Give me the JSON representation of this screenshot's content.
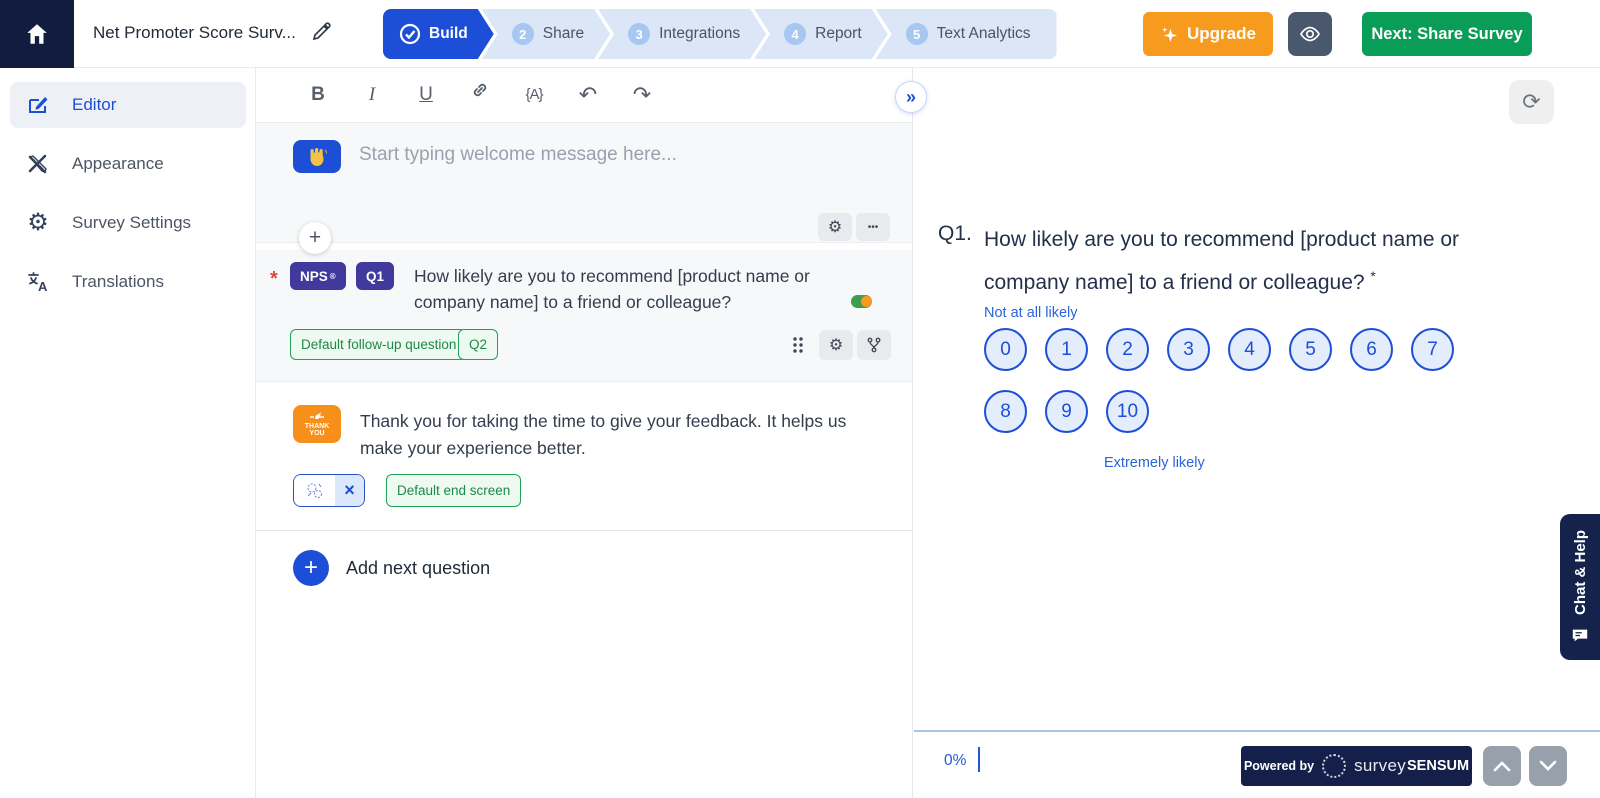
{
  "topbar": {
    "survey_title": "Net Promoter Score Surv...",
    "steps": [
      {
        "label": "Build",
        "number": "",
        "state": "active"
      },
      {
        "label": "Share",
        "number": "2",
        "state": "upcoming"
      },
      {
        "label": "Integrations",
        "number": "3",
        "state": "upcoming"
      },
      {
        "label": "Report",
        "number": "4",
        "state": "upcoming"
      },
      {
        "label": "Text Analytics",
        "number": "5",
        "state": "upcoming"
      }
    ],
    "upgrade_label": "Upgrade",
    "next_label": "Next: Share Survey"
  },
  "sidebar": {
    "items": [
      {
        "label": "Editor",
        "active": true
      },
      {
        "label": "Appearance",
        "active": false
      },
      {
        "label": "Survey Settings",
        "active": false
      },
      {
        "label": "Translations",
        "active": false
      }
    ]
  },
  "toolbar": {
    "bold": "B",
    "italic": "I",
    "underline": "U",
    "variable": "{A}"
  },
  "editor": {
    "welcome": {
      "placeholder": "Start typing welcome message here..."
    },
    "nps": {
      "required_marker": "*",
      "type_badge": "NPS",
      "type_reg": "®",
      "q_badge": "Q1",
      "question": "How likely are you to recommend [product name or company name] to a friend or colleague?",
      "toggle_state": "on",
      "followup_tag": "Default follow-up question",
      "followup_q": "Q2"
    },
    "thankyou": {
      "icon_line1": "THANK",
      "icon_line2": "YOU",
      "message": "Thank you for taking the time to give your feedback. It helps us make your experience better.",
      "end_tag": "Default end screen"
    },
    "add_next_label": "Add next question"
  },
  "preview": {
    "q_no": "Q1.",
    "question": "How likely are you to recommend [product name or company name] to a friend or colleague?",
    "required_marker": "*",
    "low_label": "Not at all likely",
    "high_label": "Extremely likely",
    "scale": [
      "0",
      "1",
      "2",
      "3",
      "4",
      "5",
      "6",
      "7",
      "8",
      "9",
      "10"
    ],
    "progress": "0%",
    "powered_prefix": "Powered by",
    "brand_light": "survey",
    "brand_bold": "SENSUM"
  },
  "chat_tab_label": "Chat & Help",
  "icons": {
    "undo": "↶",
    "redo": "↷",
    "more": "•••",
    "collapse": "»",
    "refresh": "⟳",
    "gear": "⚙",
    "close": "×",
    "plus": "+",
    "add": "+"
  },
  "colors": {
    "accent_blue": "#1d4ed8",
    "step_light": "#dbe6f6",
    "green": "#0a9d58",
    "orange": "#f79b1f",
    "purple_badge": "#41399b",
    "tag_green": "#1fa355",
    "navy": "#15204a",
    "toggle_green": "#3e9e4e"
  }
}
